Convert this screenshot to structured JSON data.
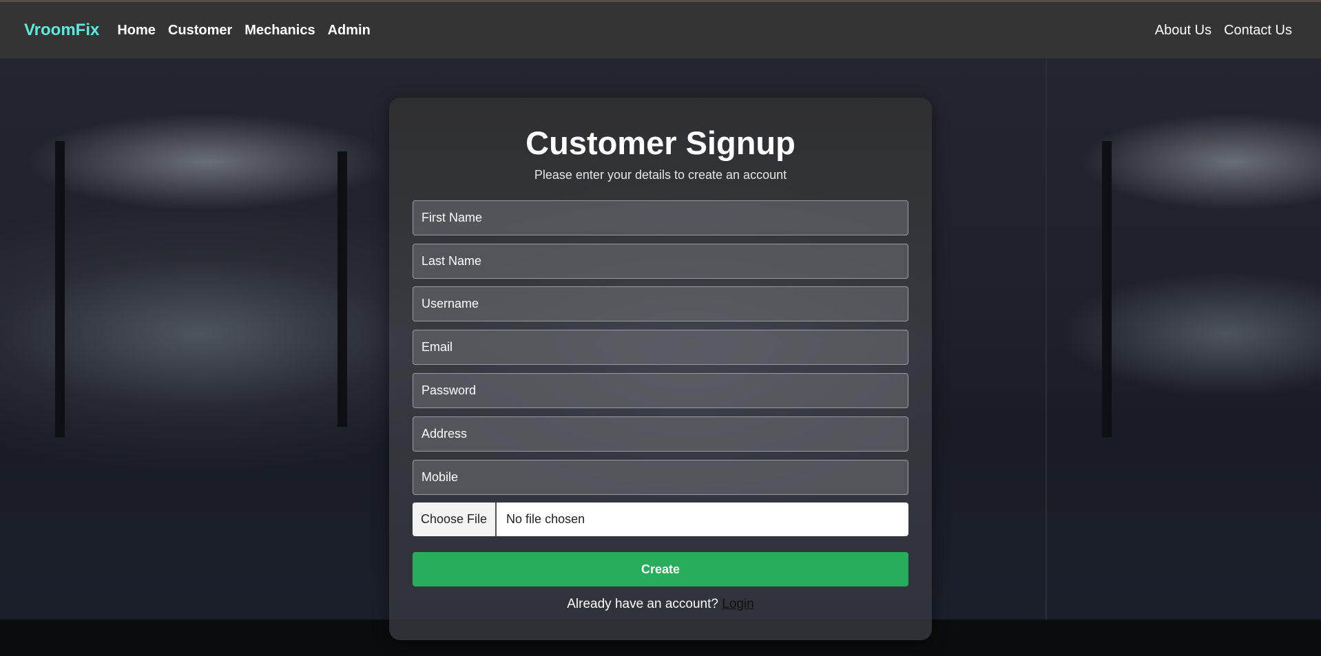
{
  "navbar": {
    "brand": "VroomFix",
    "left_links": [
      "Home",
      "Customer",
      "Mechanics",
      "Admin"
    ],
    "right_links": [
      "About Us",
      "Contact Us"
    ]
  },
  "form": {
    "title": "Customer Signup",
    "subtitle": "Please enter your details to create an account",
    "fields": {
      "first_name": "First Name",
      "last_name": "Last Name",
      "username": "Username",
      "email": "Email",
      "password": "Password",
      "address": "Address",
      "mobile": "Mobile"
    },
    "file": {
      "button_label": "Choose File",
      "status": "No file chosen"
    },
    "submit_label": "Create",
    "login_prompt": "Already have an account?",
    "login_link": "Login"
  },
  "colors": {
    "brand": "#5eeadf",
    "navbar_bg": "#343434",
    "create_button": "#28ad5d"
  }
}
